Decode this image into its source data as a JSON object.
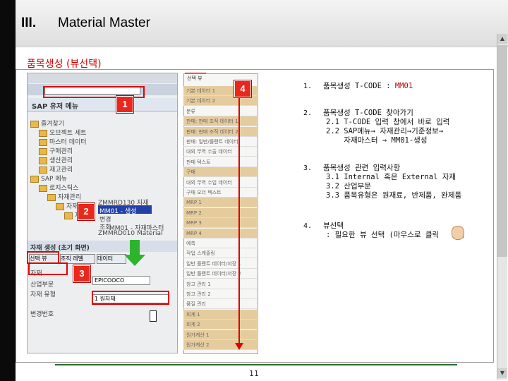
{
  "header": {
    "section_number": "III.",
    "section_title": "Material Master"
  },
  "subtitle": "품목생성 (뷰선택)",
  "badges": {
    "b1": "1",
    "b2": "2",
    "b3": "3",
    "b4": "4"
  },
  "sap_screen": {
    "title": "SAP 유저 메뉴",
    "command_field_value": "",
    "tree_items": [
      "즐겨찾기",
      "오브젝트 세트",
      "마스터 데이터",
      "구매관리",
      "생산관리",
      "재고관리",
      "SAP 메뉴",
      "로지스틱스",
      "자재관리",
      "자재마스터",
      "자재"
    ],
    "transactions": [
      {
        "code": "ZMMRD130",
        "label": "자재"
      },
      {
        "code": "MM01",
        "label": "생성"
      },
      {
        "code": "MM02",
        "label": "변경"
      },
      {
        "code": "MM03",
        "label": "조회"
      },
      {
        "code": "MM01",
        "label": "자재마스터"
      },
      {
        "code": "ZMMRD010",
        "label": "Material"
      }
    ],
    "create_screen_title": "자재 생성 (초기 화면)",
    "tabs": [
      "선택 뷰",
      "조직 레벨",
      "데이터"
    ],
    "field_labels": [
      "자재",
      "산업부문",
      "자재 유형",
      "",
      "변경번호"
    ],
    "material_value": "EPICOOCO",
    "material_type_value": "1 원자재"
  },
  "view_list": {
    "items": [
      {
        "label": "기본 데이터 1",
        "highlight": true
      },
      {
        "label": "기본 데이터 2",
        "highlight": true
      },
      {
        "label": "분류",
        "highlight": false
      },
      {
        "label": "판매: 판매 조직 데이터 1",
        "highlight": true
      },
      {
        "label": "판매: 판매 조직 데이터 2",
        "highlight": true
      },
      {
        "label": "판매: 일반/플랜트 데이터",
        "highlight": false
      },
      {
        "label": "대외 무역 수출 데이터",
        "highlight": false
      },
      {
        "label": "판매 텍스트",
        "highlight": false
      },
      {
        "label": "구매",
        "highlight": true
      },
      {
        "label": "대외 무역 수입 데이터",
        "highlight": false
      },
      {
        "label": "구매 오더 텍스트",
        "highlight": false
      },
      {
        "label": "MRP 1",
        "highlight": true
      },
      {
        "label": "MRP 2",
        "highlight": true
      },
      {
        "label": "MRP 3",
        "highlight": true
      },
      {
        "label": "MRP 4",
        "highlight": true
      },
      {
        "label": "예측",
        "highlight": false
      },
      {
        "label": "작업 스케줄링",
        "highlight": false
      },
      {
        "label": "일반 플랜트 데이터/저장 1",
        "highlight": false
      },
      {
        "label": "일반 플랜트 데이터/저장 2",
        "highlight": false
      },
      {
        "label": "창고 관리 1",
        "highlight": false
      },
      {
        "label": "창고 관리 2",
        "highlight": false
      },
      {
        "label": "품질 관리",
        "highlight": false
      },
      {
        "label": "회계 1",
        "highlight": true
      },
      {
        "label": "회계 2",
        "highlight": true
      },
      {
        "label": "원가계산 1",
        "highlight": true
      },
      {
        "label": "원가계산 2",
        "highlight": true
      }
    ],
    "header_chip": "선택 뷰"
  },
  "instructions": [
    {
      "num": "1.",
      "lines": [
        "품목생성 T-CODE : MM01"
      ]
    },
    {
      "num": "2.",
      "lines": [
        "품목생성 T-CODE 찾아가기",
        "2.1 T-CODE 입력 창에서 바로 입력",
        "2.2 SAP메뉴→ 자재관리→기준정보→",
        "    자재마스터 → MM01-생성"
      ]
    },
    {
      "num": "3.",
      "lines": [
        "품목생성 관련 입력사항",
        "3.1 Internal 혹은 External 자재",
        "3.2 산업부문",
        "3.3 품목유형은 원재료, 반제품, 완제품"
      ]
    },
    {
      "num": "4.",
      "lines": [
        "뷰선택",
        ": 필요한 뷰 선택 (마우스로 클릭     )"
      ]
    }
  ],
  "footer": {
    "page_number": "11"
  }
}
